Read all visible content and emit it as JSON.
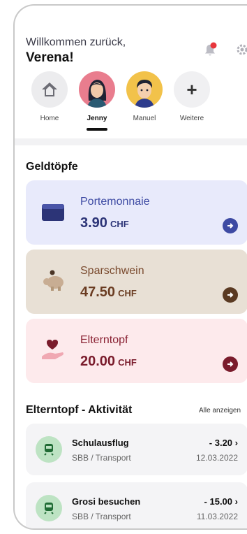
{
  "header": {
    "greeting": "Willkommen zurück,",
    "user_name": "Verena!"
  },
  "colors": {
    "notification_dot": "#e8363c",
    "accent_blue": "#3d4aa3",
    "accent_brown": "#5a3a22",
    "accent_pink": "#7a1c2c"
  },
  "profiles": [
    {
      "label": "Home",
      "icon": "home-icon",
      "active": false
    },
    {
      "label": "Jenny",
      "icon": "jenny-avatar",
      "active": true
    },
    {
      "label": "Manuel",
      "icon": "manuel-avatar",
      "active": false
    },
    {
      "label": "Weitere",
      "icon": "plus-icon",
      "active": false
    }
  ],
  "pots_section": {
    "title": "Geldtöpfe"
  },
  "pots": [
    {
      "label": "Portemonnaie",
      "amount": "3.90",
      "currency": "CHF",
      "icon": "wallet-icon"
    },
    {
      "label": "Sparschwein",
      "amount": "47.50",
      "currency": "CHF",
      "icon": "piggy-bank-icon"
    },
    {
      "label": "Elterntopf",
      "amount": "20.00",
      "currency": "CHF",
      "icon": "heart-hand-icon"
    }
  ],
  "activity_section": {
    "title": "Elterntopf - Aktivität",
    "show_all": "Alle anzeigen"
  },
  "activities": [
    {
      "title": "Schulausflug",
      "subtitle": "SBB / Transport",
      "amount": "- 3.20",
      "date": "12.03.2022",
      "icon": "train-icon"
    },
    {
      "title": "Grosi besuchen",
      "subtitle": "SBB / Transport",
      "amount": "- 15.00",
      "date": "11.03.2022",
      "icon": "train-icon"
    }
  ]
}
